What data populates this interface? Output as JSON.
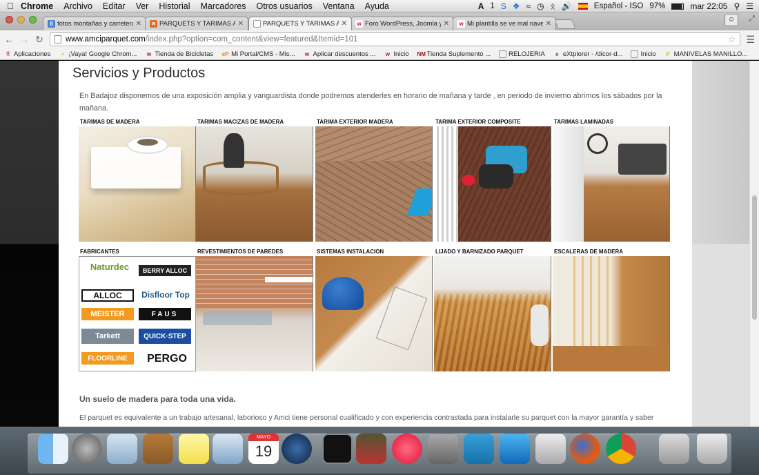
{
  "menubar": {
    "app": "Chrome",
    "items": [
      "Archivo",
      "Editar",
      "Ver",
      "Historial",
      "Marcadores",
      "Otros usuarios",
      "Ventana",
      "Ayuda"
    ],
    "status_ai": "1",
    "language": "Español - ISO",
    "battery": "97%",
    "clock": "mar 22:05"
  },
  "tabs": [
    {
      "title": "fotos montañas y carreteras",
      "favicon": "google-icon",
      "color": "#4a7fd6",
      "letter": "8"
    },
    {
      "title": "PARQUETS Y TARIMAS AMCI",
      "favicon": "joomla-icon",
      "color": "#e26a28",
      "letter": "✕"
    },
    {
      "title": "PARQUETS Y TARIMAS AMCI",
      "favicon": "page-icon",
      "color": "#ffffff",
      "letter": ""
    },
    {
      "title": "Foro WordPress, Joomla y ...",
      "favicon": "w-icon",
      "color": "#c8102e",
      "letter": "w"
    },
    {
      "title": "Mi plantilla se ve mal nave...",
      "favicon": "w-icon",
      "color": "#c8102e",
      "letter": "w"
    }
  ],
  "toolbar": {
    "url_host": "www.amciparquet.com",
    "url_path": "/index.php?option=com_content&view=featured&Itemid=101"
  },
  "bookmarks": [
    {
      "label": "Aplicaciones",
      "icon": "apps-icon",
      "color": "#d04a2a",
      "letter": "⠿"
    },
    {
      "label": "¡Vaya! Google Chrom...",
      "icon": "chrome-error-icon",
      "color": "#e3a11a",
      "letter": "•"
    },
    {
      "label": "Tienda de Bicicletas",
      "icon": "w-icon",
      "color": "#c8102e",
      "letter": "w"
    },
    {
      "label": "Mi Portal/CMS - Mis...",
      "icon": "cp-icon",
      "color": "#e07b00",
      "letter": "cP"
    },
    {
      "label": "Aplicar descuentos ...",
      "icon": "w-icon",
      "color": "#c8102e",
      "letter": "w"
    },
    {
      "label": "Inicio",
      "icon": "w-icon",
      "color": "#c8102e",
      "letter": "w"
    },
    {
      "label": "Tienda Suplemento ...",
      "icon": "nm-icon",
      "color": "#a01010",
      "letter": "NM"
    },
    {
      "label": "RELOJERIA",
      "icon": "page-icon",
      "color": "#888888",
      "letter": ""
    },
    {
      "label": "eXtplorer - /dicor-d...",
      "icon": "extplorer-icon",
      "color": "#3a7d2a",
      "letter": "e"
    },
    {
      "label": "Inicio",
      "icon": "page-icon",
      "color": "#888888",
      "letter": ""
    },
    {
      "label": "MANIVELAS MANILLO...",
      "icon": "p-icon",
      "color": "#b8c020",
      "letter": "P"
    }
  ],
  "page": {
    "title": "Servicios y Productos",
    "intro": "En Badajoz disponemos de una exposición amplia y vanguardista donde podremos atenderles en horario de mañana y tarde , en periodo de invierno abrimos los sábados por la mañana.",
    "row1": [
      "TARIMAS DE MADERA",
      "TARIMAS MACIZAS DE MADERA",
      "TARIMA EXTERIOR MADERA",
      "TARIMA EXTERIOR COMPOSITE",
      "TARIMAS LAMINADAS"
    ],
    "row2": [
      "FABRICANTES",
      "REVESTIMIENTOS DE PAREDES",
      "SISTEMAS  INSTALACION",
      "LIJADO Y BARNIZADO PARQUET",
      "ESCALERAS DE MADERA"
    ],
    "brands": [
      "Naturdec",
      "BERRY ALLOC",
      "ALLOC",
      "Disfloor Top",
      "MEISTER",
      "FAUS",
      "Tarkett",
      "QUICK·STEP",
      "FLOORLINE",
      "PERGO"
    ],
    "heading2": "Un suelo de madera para toda una vida.",
    "paragraph": "El parquet es equivalente a un trabajo artesanal, laborioso y Amci tiene personal cualificado y con experiencia contrastada para instalarle su parquet con la mayor garantía y saber"
  },
  "dock": {
    "calendar_day": "19",
    "calendar_month": "MAYO"
  }
}
